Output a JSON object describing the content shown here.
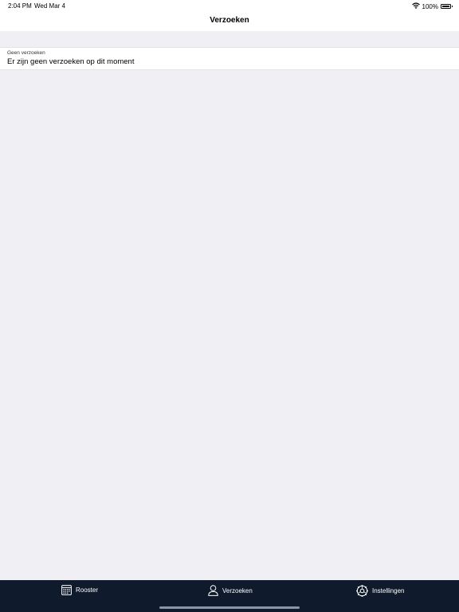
{
  "status_bar": {
    "time": "2:04 PM",
    "date": "Wed Mar 4",
    "battery": "100%",
    "battery_level": 1.0
  },
  "nav": {
    "title": "Verzoeken"
  },
  "list": {
    "items": [
      {
        "subtitle": "Geen verzoeken",
        "title": "Er zijn geen verzoeken op dit moment"
      }
    ]
  },
  "tab_bar": {
    "items": [
      {
        "label": "Rooster",
        "icon": "calendar-icon"
      },
      {
        "label": "Verzoeken",
        "icon": "person-icon"
      },
      {
        "label": "Instellingen",
        "icon": "gear-icon"
      }
    ]
  },
  "colors": {
    "background": "#efeff4",
    "tab_bar": "#0f1b2d",
    "surface": "#ffffff"
  }
}
